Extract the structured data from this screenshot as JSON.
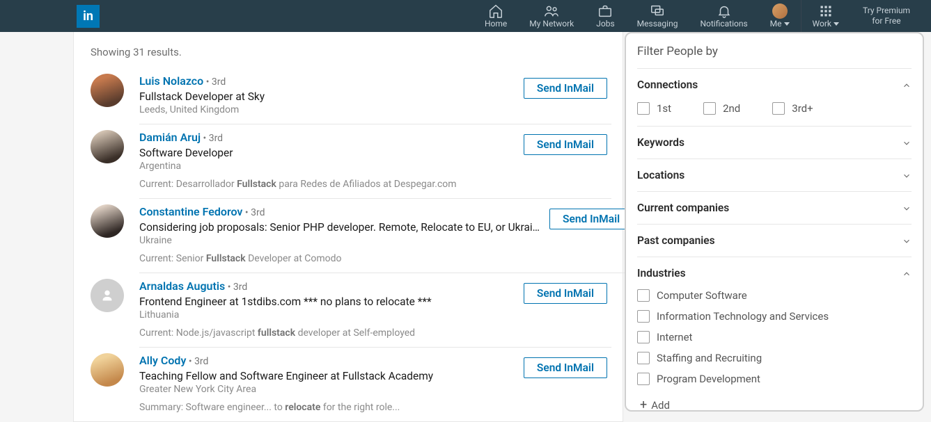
{
  "nav": {
    "logo": "in",
    "home": "Home",
    "network": "My Network",
    "jobs": "Jobs",
    "messaging": "Messaging",
    "notifications": "Notifications",
    "me": "Me",
    "work": "Work",
    "premium_l1": "Try Premium",
    "premium_l2": "for Free"
  },
  "showing": "Showing 31 results.",
  "people": [
    {
      "name": "Luis Nolazco",
      "degree": "3rd",
      "title": "Fullstack Developer at Sky",
      "location": "Leeds, United Kingdom",
      "meta_prefix": "",
      "meta_bold": "",
      "meta_suffix": "",
      "button": "Send InMail",
      "blank": false
    },
    {
      "name": "Damián Aruj",
      "degree": "3rd",
      "title": "Software Developer",
      "location": "Argentina",
      "meta_prefix": "Current: Desarrollador ",
      "meta_bold": "Fullstack",
      "meta_suffix": " para Redes de Afiliados at Despegar.com",
      "button": "Send InMail",
      "blank": false
    },
    {
      "name": "Constantine Fedorov",
      "degree": "3rd",
      "title": "Considering job proposals: Senior PHP developer. Remote, Relocate to EU, or Ukrai…",
      "location": "Ukraine",
      "meta_prefix": "Current: Senior ",
      "meta_bold": "Fullstack",
      "meta_suffix": " Developer at Comodo",
      "button": "Send InMail",
      "blank": false
    },
    {
      "name": "Arnaldas Augutis",
      "degree": "3rd",
      "title": "Frontend Engineer at 1stdibs.com *** no plans to relocate ***",
      "location": "Lithuania",
      "meta_prefix": "Current: Node.js/javascript ",
      "meta_bold": "fullstack",
      "meta_suffix": " developer at Self-employed",
      "button": "Send InMail",
      "blank": true
    },
    {
      "name": "Ally Cody",
      "degree": "3rd",
      "title": "Teaching Fellow and Software Engineer at Fullstack Academy",
      "location": "Greater New York City Area",
      "meta_prefix": "Summary: Software engineer... to ",
      "meta_bold": "relocate",
      "meta_suffix": " for the right role...",
      "button": "Send InMail",
      "blank": false
    }
  ],
  "filter": {
    "title": "Filter People by",
    "connections": {
      "label": "Connections",
      "first": "1st",
      "second": "2nd",
      "third": "3rd+"
    },
    "keywords": "Keywords",
    "locations": "Locations",
    "current_companies": "Current companies",
    "past_companies": "Past companies",
    "industries": {
      "label": "Industries",
      "items": {
        "i0": "Computer Software",
        "i1": "Information Technology and Services",
        "i2": "Internet",
        "i3": "Staffing and Recruiting",
        "i4": "Program Development"
      },
      "add": "Add"
    }
  }
}
